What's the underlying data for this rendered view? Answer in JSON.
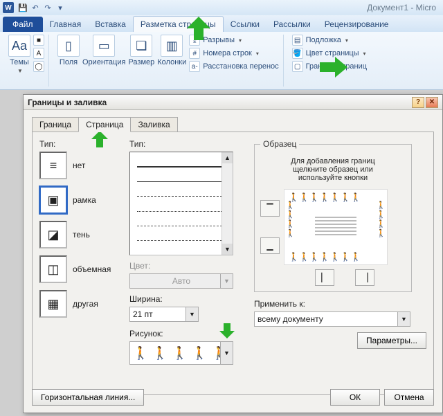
{
  "app": {
    "title": "Документ1 - Micro"
  },
  "qat": {
    "save": "save",
    "undo": "undo",
    "redo": "redo"
  },
  "tabs": {
    "file": "Файл",
    "home": "Главная",
    "insert": "Вставка",
    "layout": "Разметка страницы",
    "references": "Ссылки",
    "mailings": "Рассылки",
    "review": "Рецензирование"
  },
  "ribbon": {
    "themes": "Темы",
    "margins": "Поля",
    "orientation": "Ориентация",
    "size": "Размер",
    "columns": "Колонки",
    "breaks": "Разрывы",
    "line_numbers": "Номера строк",
    "hyphenation": "Расстановка перенос",
    "watermark": "Подложка",
    "page_color": "Цвет страницы",
    "page_borders": "Границы страниц"
  },
  "dialog": {
    "title": "Границы и заливка",
    "tabs": {
      "border": "Граница",
      "page": "Страница",
      "fill": "Заливка"
    },
    "type_label": "Тип:",
    "types": {
      "none": "нет",
      "box": "рамка",
      "shadow": "тень",
      "threeD": "объемная",
      "custom": "другая"
    },
    "style_label": "Тип:",
    "color_label": "Цвет:",
    "color_auto": "Авто",
    "width_label": "Ширина:",
    "width_value": "21 пт",
    "art_label": "Рисунок:",
    "preview_legend": "Образец",
    "preview_hint1": "Для добавления границ",
    "preview_hint2": "щелкните образец или",
    "preview_hint3": "используйте кнопки",
    "apply_label": "Применить к:",
    "apply_value": "всему документу",
    "options": "Параметры...",
    "hline": "Горизонтальная линия...",
    "ok": "ОК",
    "cancel": "Отмена"
  }
}
